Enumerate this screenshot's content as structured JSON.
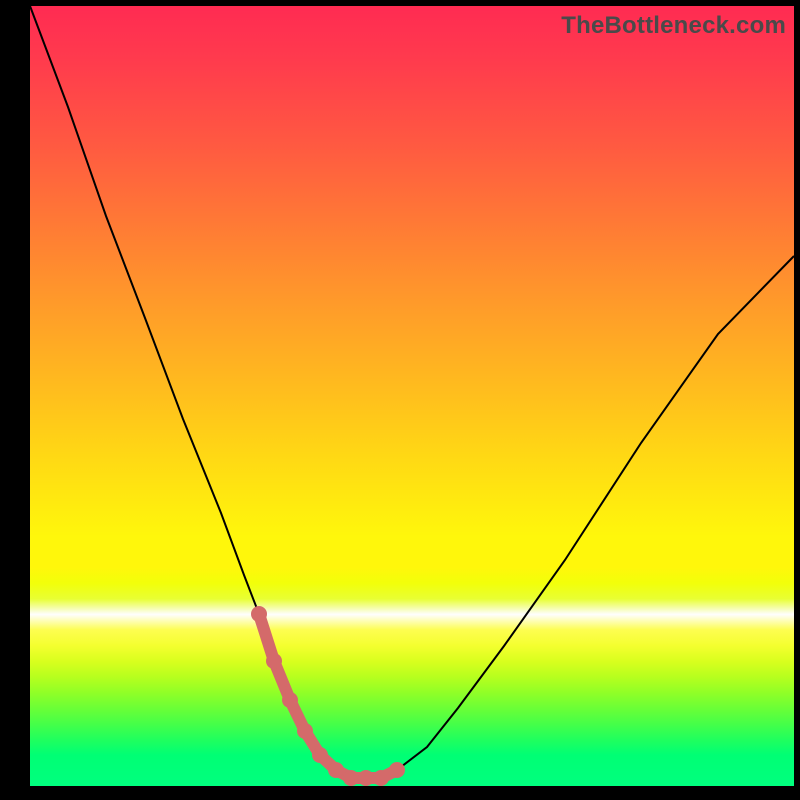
{
  "watermark": "TheBottleneck.com",
  "chart_data": {
    "type": "line",
    "title": "",
    "xlabel": "",
    "ylabel": "",
    "xlim": [
      0,
      100
    ],
    "ylim": [
      0,
      100
    ],
    "grid": false,
    "legend": false,
    "series": [
      {
        "name": "bottleneck-curve",
        "x": [
          0,
          5,
          10,
          15,
          20,
          25,
          28,
          30,
          32,
          34,
          36,
          38,
          40,
          42,
          44,
          46,
          48,
          52,
          56,
          62,
          70,
          80,
          90,
          100
        ],
        "y": [
          100,
          87,
          73,
          60,
          47,
          35,
          27,
          22,
          16,
          11,
          7,
          4,
          2,
          1,
          1,
          1,
          2,
          5,
          10,
          18,
          29,
          44,
          58,
          68
        ]
      }
    ],
    "annotations": [
      {
        "name": "optimal-zone",
        "x": [
          30,
          32,
          34,
          36,
          38,
          40,
          42,
          44,
          46,
          48
        ],
        "y": [
          22,
          16,
          11,
          7,
          4,
          2,
          1,
          1,
          1,
          2
        ],
        "style": "thick-salmon"
      }
    ],
    "background": "rainbow-vertical-gradient"
  }
}
